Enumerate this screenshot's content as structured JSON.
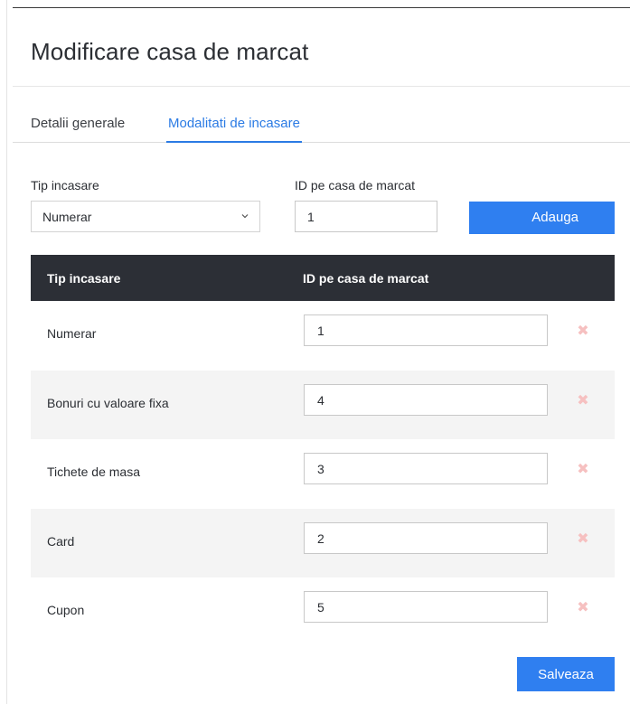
{
  "dialog": {
    "title": "Modificare casa de marcat"
  },
  "tabs": [
    {
      "label": "Detalii generale",
      "active": false
    },
    {
      "label": "Modalitati de incasare",
      "active": true
    }
  ],
  "form": {
    "tip_label": "Tip incasare",
    "tip_value": "Numerar",
    "id_label": "ID pe casa de marcat",
    "id_value": "1",
    "add_button": "Adauga"
  },
  "table": {
    "headers": [
      "Tip incasare",
      "ID pe casa de marcat"
    ],
    "rows": [
      {
        "name": "Numerar",
        "id": "1"
      },
      {
        "name": "Bonuri cu valoare fixa",
        "id": "4"
      },
      {
        "name": "Tichete de masa",
        "id": "3"
      },
      {
        "name": "Card",
        "id": "2"
      },
      {
        "name": "Cupon",
        "id": "5"
      }
    ],
    "delete_icon": "close-icon"
  },
  "footer": {
    "save_button": "Salveaza"
  },
  "colors": {
    "accent": "#2f7ff0",
    "header_bg": "#2c2f36",
    "row_alt": "#f4f4f4",
    "delete_icon": "#f6c0c0",
    "active_tab": "#2b7be4"
  }
}
